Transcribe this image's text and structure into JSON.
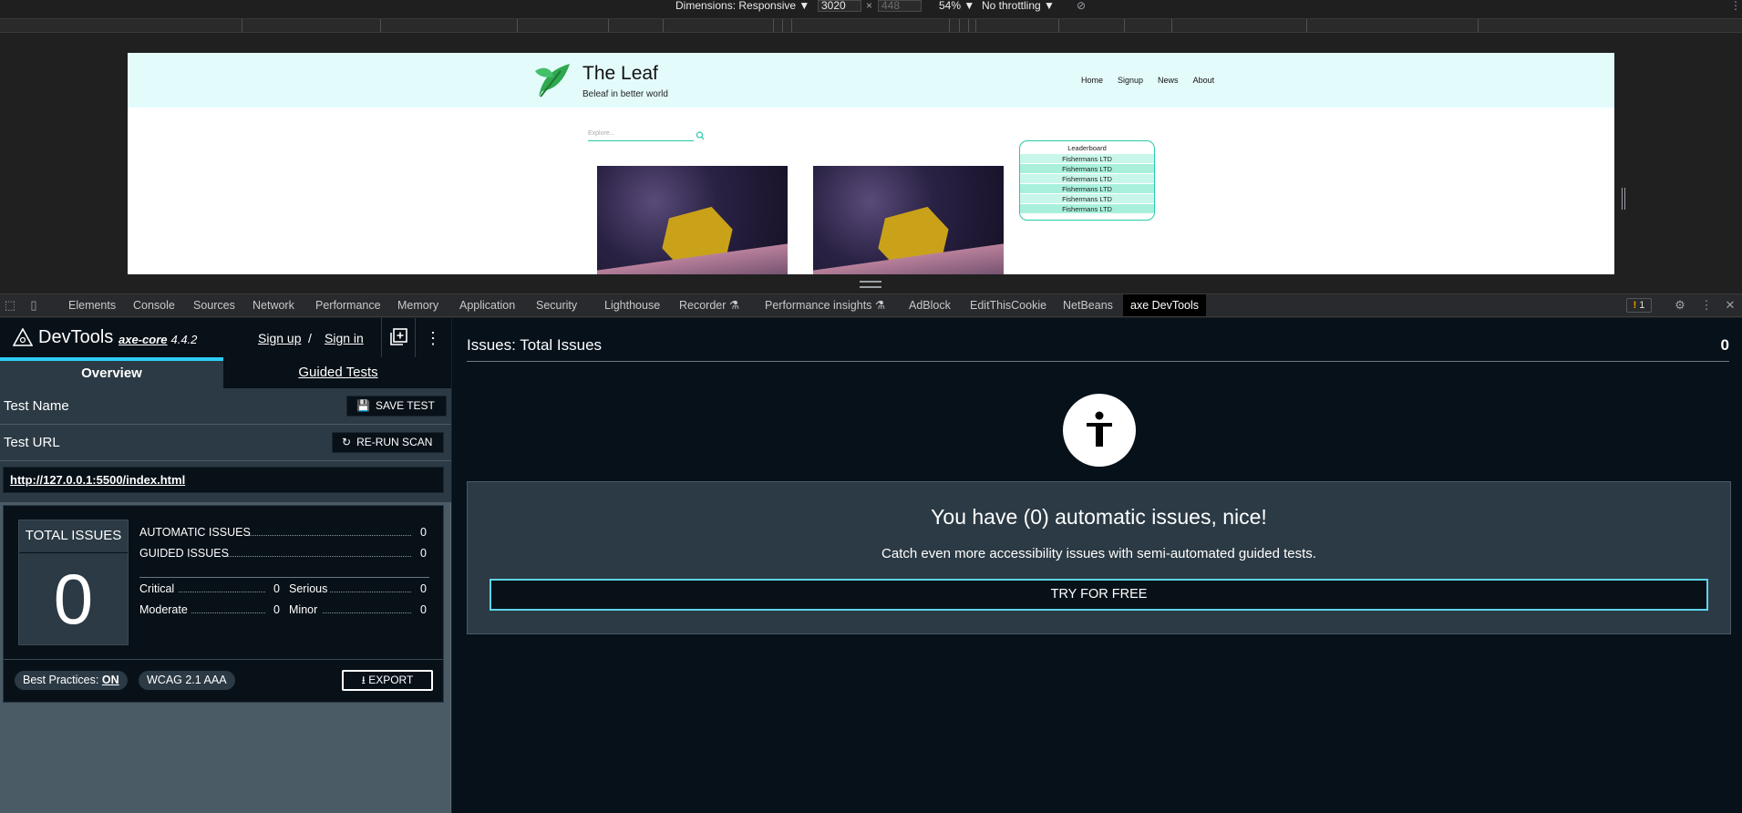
{
  "device_toolbar": {
    "dimensions_label": "Dimensions: Responsive ▼",
    "width": "3020",
    "height": "448",
    "zoom": "54% ▼",
    "throttling": "No throttling ▼"
  },
  "site": {
    "title": "The Leaf",
    "tagline": "Beleaf in better world",
    "nav": [
      "Home",
      "Signup",
      "News",
      "About"
    ],
    "search_placeholder": "Explore...",
    "leaderboard": {
      "title": "Leaderboard",
      "rows": [
        "Fishermans LTD",
        "Fishermans LTD",
        "Fishermans LTD",
        "Fishermans LTD",
        "Fishermans LTD",
        "Fishermans LTD"
      ]
    }
  },
  "devtools_tabs": [
    {
      "label": "Elements",
      "active": false
    },
    {
      "label": "Console",
      "active": false
    },
    {
      "label": "Sources",
      "active": false
    },
    {
      "label": "Network",
      "active": false
    },
    {
      "label": "Performance",
      "active": false
    },
    {
      "label": "Memory",
      "active": false
    },
    {
      "label": "Application",
      "active": false
    },
    {
      "label": "Security",
      "active": false
    },
    {
      "label": "Lighthouse",
      "active": false
    },
    {
      "label": "Recorder ⚗",
      "active": false
    },
    {
      "label": "Performance insights ⚗",
      "active": false
    },
    {
      "label": "AdBlock",
      "active": false
    },
    {
      "label": "EditThisCookie",
      "active": false
    },
    {
      "label": "NetBeans",
      "active": false
    },
    {
      "label": "axe DevTools",
      "active": true
    }
  ],
  "issues_badge": "1",
  "axe": {
    "brand": "DevTools",
    "core_label": "axe-core",
    "version": "4.4.2",
    "sign_up": "Sign up",
    "slash": "/",
    "sign_in": "Sign in",
    "tabs": {
      "overview": "Overview",
      "guided": "Guided Tests"
    },
    "test_name_label": "Test Name",
    "save_test": "SAVE TEST",
    "test_url_label": "Test URL",
    "rerun_scan": "RE-RUN SCAN",
    "url": "http://127.0.0.1:5500/index.html",
    "summary": {
      "total_label": "TOTAL ISSUES",
      "total": "0",
      "automatic_label": "AUTOMATIC ISSUES",
      "automatic": "0",
      "guided_label": "GUIDED ISSUES",
      "guided": "0",
      "critical_label": "Critical",
      "critical": "0",
      "serious_label": "Serious",
      "serious": "0",
      "moderate_label": "Moderate",
      "moderate": "0",
      "minor_label": "Minor",
      "minor": "0"
    },
    "best_practices_label": "Best Practices:",
    "best_practices_value": "ON",
    "wcag": "WCAG 2.1 AAA",
    "export": "EXPORT",
    "issues_title": "Issues: Total Issues",
    "issues_total": "0",
    "result_heading": "You have (0) automatic issues, nice!",
    "result_sub": "Catch even more accessibility issues with semi-automated guided tests.",
    "try_free": "TRY FOR FREE"
  },
  "colors": {
    "accent": "#2dcdf5",
    "panel": "#2b3a44",
    "dark": "#081118",
    "site_accent": "#27c9a8"
  },
  "icons": [
    "inspect-icon",
    "device-toggle-icon",
    "gear-icon",
    "kebab-icon",
    "close-icon",
    "save-icon",
    "refresh-icon",
    "download-icon",
    "accessibility-icon",
    "search-icon",
    "leaf-logo-icon",
    "axe-logo-icon",
    "new-test-icon"
  ]
}
